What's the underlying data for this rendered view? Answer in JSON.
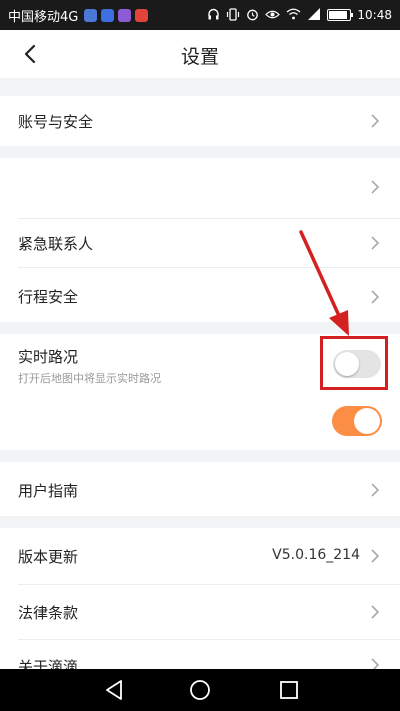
{
  "status_bar": {
    "carrier": "中国移动4G",
    "time": "10:48",
    "app_icon_colors": [
      "#4a78d6",
      "#3d6fe0",
      "#8e5bd6",
      "#e0443a"
    ]
  },
  "header": {
    "title": "设置"
  },
  "settings": {
    "account_security": "账号与安全",
    "emergency_contact": "紧急联系人",
    "trip_safety": "行程安全",
    "realtime_traffic": {
      "label": "实时路况",
      "description": "打开后地图中将显示实时路况",
      "enabled": false
    },
    "second_toggle": {
      "enabled": true
    },
    "user_guide": "用户指南",
    "version_update": {
      "label": "版本更新",
      "value": "V5.0.16_214"
    },
    "legal_terms": "法律条款",
    "about": "关于滴滴"
  },
  "colors": {
    "accent_orange": "#fb8d45",
    "highlight_red": "#d42020"
  }
}
